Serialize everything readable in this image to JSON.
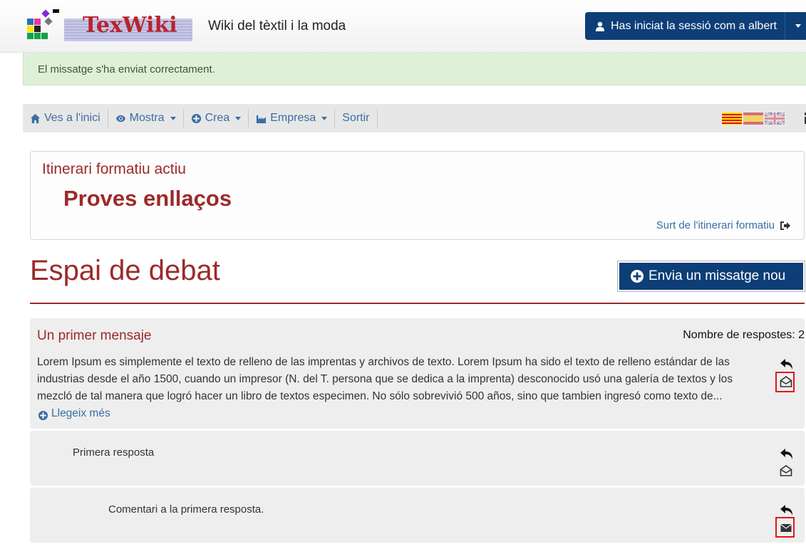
{
  "header": {
    "logo_text": "TexWiki",
    "tagline": "Wiki del tèxtil i la moda",
    "user_label": "Has iniciat la sessió com a albert"
  },
  "alert": {
    "message": "El missatge s'ha enviat correctament."
  },
  "nav": {
    "home": "Ves a l'inici",
    "show": "Mostra",
    "create": "Crea",
    "company": "Empresa",
    "logout": "Sortir",
    "languages": [
      "ca",
      "es",
      "en"
    ]
  },
  "itinerary": {
    "label": "Itinerari formatiu actiu",
    "title": "Proves enllaços",
    "exit_label": "Surt de l'itinerari formatiu"
  },
  "page": {
    "title": "Espai de debat",
    "new_message_button": "Envia un missatge nou"
  },
  "thread": {
    "title": "Un primer mensaje",
    "reply_count": "Nombre de respostes: 2",
    "body": "Lorem Ipsum es simplemente el texto de relleno de las imprentas y archivos de texto. Lorem Ipsum ha sido el texto de relleno estándar de las industrias desde el año 1500, cuando un impresor (N. del T. persona que se dedica a la imprenta) desconocido usó una galería de textos y los mezcló de tal manera que logró hacer un libro de textos especimen. No sólo sobrevivió 500 años, sino que tambien ingresó como texto de...",
    "read_more": "Llegeix més",
    "replies": [
      {
        "text": "Primera resposta",
        "read": true
      },
      {
        "text": "Comentari a la primera resposta.",
        "read": false
      }
    ]
  },
  "colors": {
    "brand_blue": "#0d3e78",
    "title_red": "#9c2a2a",
    "link_blue": "#3a6ea5",
    "success_bg": "#dff0d8",
    "highlight_red": "#e0161e"
  },
  "icons": [
    "user-icon",
    "home-icon",
    "eye-icon",
    "plus-circle-icon",
    "factory-icon",
    "sign-out-icon",
    "reply-icon",
    "envelope-open-icon",
    "envelope-closed-icon",
    "info-icon"
  ]
}
